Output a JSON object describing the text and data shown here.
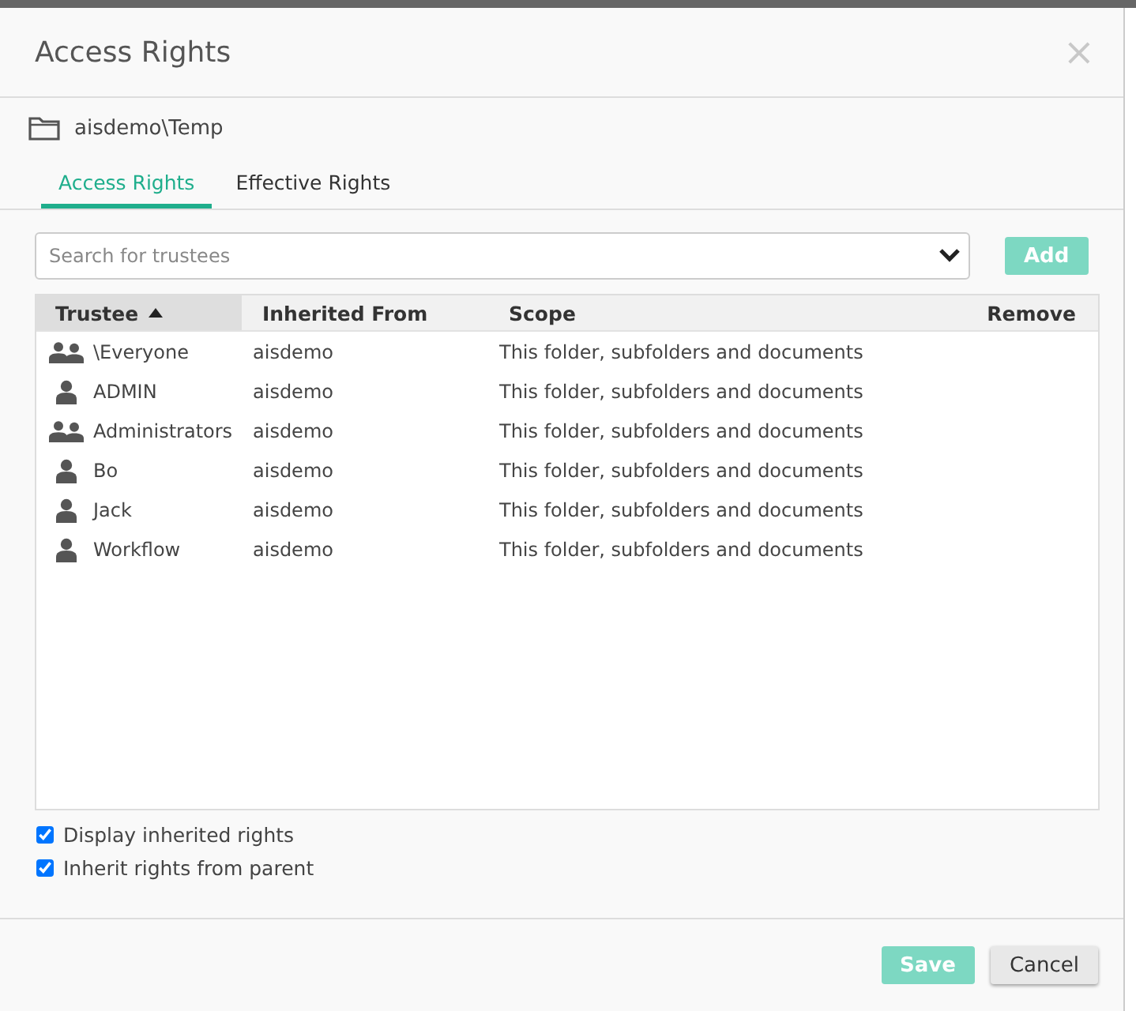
{
  "dialog": {
    "title": "Access Rights",
    "close": "×"
  },
  "location": {
    "path": "aisdemo\\Temp"
  },
  "tabs": [
    {
      "label": "Access Rights",
      "selected": true
    },
    {
      "label": "Effective Rights",
      "selected": false
    }
  ],
  "search": {
    "placeholder": "Search for trustees"
  },
  "add_button": {
    "label": "Add",
    "disabled": true
  },
  "table": {
    "columns": [
      {
        "label": "Trustee",
        "sorted": true
      },
      {
        "label": "Inherited From",
        "sorted": false
      },
      {
        "label": "Scope",
        "sorted": false
      },
      {
        "label": "Remove",
        "sorted": false
      }
    ],
    "rows": [
      {
        "kind": "group",
        "trustee": "\\Everyone",
        "inherited_from": "aisdemo",
        "scope": "This folder, subfolders and documents"
      },
      {
        "kind": "user",
        "trustee": "ADMIN",
        "inherited_from": "aisdemo",
        "scope": "This folder, subfolders and documents"
      },
      {
        "kind": "group",
        "trustee": "Administrators",
        "inherited_from": "aisdemo",
        "scope": "This folder, subfolders and documents"
      },
      {
        "kind": "user",
        "trustee": "Bo",
        "inherited_from": "aisdemo",
        "scope": "This folder, subfolders and documents"
      },
      {
        "kind": "user",
        "trustee": "Jack",
        "inherited_from": "aisdemo",
        "scope": "This folder, subfolders and documents"
      },
      {
        "kind": "user",
        "trustee": "Workflow",
        "inherited_from": "aisdemo",
        "scope": "This folder, subfolders and documents"
      }
    ]
  },
  "options": [
    {
      "label": "Display inherited rights",
      "checked": true
    },
    {
      "label": "Inherit rights from parent",
      "checked": true
    }
  ],
  "buttons": [
    {
      "label": "Save",
      "kind": "primary",
      "disabled": true
    },
    {
      "label": "Cancel",
      "kind": "secondary",
      "disabled": false
    }
  ]
}
